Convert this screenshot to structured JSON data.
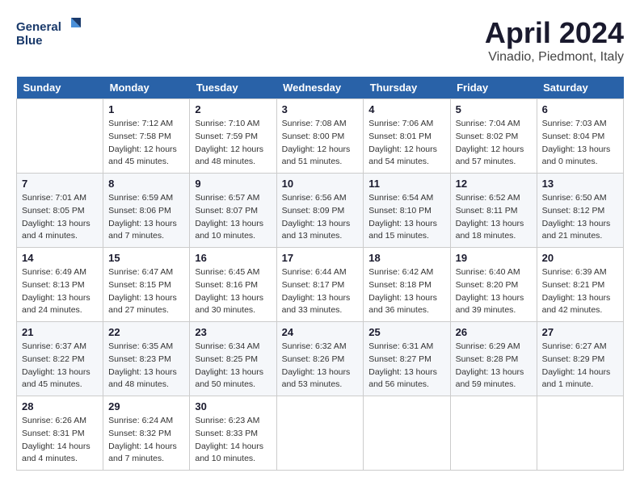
{
  "logo": {
    "text_line1": "General",
    "text_line2": "Blue"
  },
  "title": {
    "month_year": "April 2024",
    "location": "Vinadio, Piedmont, Italy"
  },
  "columns": [
    "Sunday",
    "Monday",
    "Tuesday",
    "Wednesday",
    "Thursday",
    "Friday",
    "Saturday"
  ],
  "weeks": [
    [
      {
        "day": "",
        "info": ""
      },
      {
        "day": "1",
        "info": "Sunrise: 7:12 AM\nSunset: 7:58 PM\nDaylight: 12 hours\nand 45 minutes."
      },
      {
        "day": "2",
        "info": "Sunrise: 7:10 AM\nSunset: 7:59 PM\nDaylight: 12 hours\nand 48 minutes."
      },
      {
        "day": "3",
        "info": "Sunrise: 7:08 AM\nSunset: 8:00 PM\nDaylight: 12 hours\nand 51 minutes."
      },
      {
        "day": "4",
        "info": "Sunrise: 7:06 AM\nSunset: 8:01 PM\nDaylight: 12 hours\nand 54 minutes."
      },
      {
        "day": "5",
        "info": "Sunrise: 7:04 AM\nSunset: 8:02 PM\nDaylight: 12 hours\nand 57 minutes."
      },
      {
        "day": "6",
        "info": "Sunrise: 7:03 AM\nSunset: 8:04 PM\nDaylight: 13 hours\nand 0 minutes."
      }
    ],
    [
      {
        "day": "7",
        "info": "Sunrise: 7:01 AM\nSunset: 8:05 PM\nDaylight: 13 hours\nand 4 minutes."
      },
      {
        "day": "8",
        "info": "Sunrise: 6:59 AM\nSunset: 8:06 PM\nDaylight: 13 hours\nand 7 minutes."
      },
      {
        "day": "9",
        "info": "Sunrise: 6:57 AM\nSunset: 8:07 PM\nDaylight: 13 hours\nand 10 minutes."
      },
      {
        "day": "10",
        "info": "Sunrise: 6:56 AM\nSunset: 8:09 PM\nDaylight: 13 hours\nand 13 minutes."
      },
      {
        "day": "11",
        "info": "Sunrise: 6:54 AM\nSunset: 8:10 PM\nDaylight: 13 hours\nand 15 minutes."
      },
      {
        "day": "12",
        "info": "Sunrise: 6:52 AM\nSunset: 8:11 PM\nDaylight: 13 hours\nand 18 minutes."
      },
      {
        "day": "13",
        "info": "Sunrise: 6:50 AM\nSunset: 8:12 PM\nDaylight: 13 hours\nand 21 minutes."
      }
    ],
    [
      {
        "day": "14",
        "info": "Sunrise: 6:49 AM\nSunset: 8:13 PM\nDaylight: 13 hours\nand 24 minutes."
      },
      {
        "day": "15",
        "info": "Sunrise: 6:47 AM\nSunset: 8:15 PM\nDaylight: 13 hours\nand 27 minutes."
      },
      {
        "day": "16",
        "info": "Sunrise: 6:45 AM\nSunset: 8:16 PM\nDaylight: 13 hours\nand 30 minutes."
      },
      {
        "day": "17",
        "info": "Sunrise: 6:44 AM\nSunset: 8:17 PM\nDaylight: 13 hours\nand 33 minutes."
      },
      {
        "day": "18",
        "info": "Sunrise: 6:42 AM\nSunset: 8:18 PM\nDaylight: 13 hours\nand 36 minutes."
      },
      {
        "day": "19",
        "info": "Sunrise: 6:40 AM\nSunset: 8:20 PM\nDaylight: 13 hours\nand 39 minutes."
      },
      {
        "day": "20",
        "info": "Sunrise: 6:39 AM\nSunset: 8:21 PM\nDaylight: 13 hours\nand 42 minutes."
      }
    ],
    [
      {
        "day": "21",
        "info": "Sunrise: 6:37 AM\nSunset: 8:22 PM\nDaylight: 13 hours\nand 45 minutes."
      },
      {
        "day": "22",
        "info": "Sunrise: 6:35 AM\nSunset: 8:23 PM\nDaylight: 13 hours\nand 48 minutes."
      },
      {
        "day": "23",
        "info": "Sunrise: 6:34 AM\nSunset: 8:25 PM\nDaylight: 13 hours\nand 50 minutes."
      },
      {
        "day": "24",
        "info": "Sunrise: 6:32 AM\nSunset: 8:26 PM\nDaylight: 13 hours\nand 53 minutes."
      },
      {
        "day": "25",
        "info": "Sunrise: 6:31 AM\nSunset: 8:27 PM\nDaylight: 13 hours\nand 56 minutes."
      },
      {
        "day": "26",
        "info": "Sunrise: 6:29 AM\nSunset: 8:28 PM\nDaylight: 13 hours\nand 59 minutes."
      },
      {
        "day": "27",
        "info": "Sunrise: 6:27 AM\nSunset: 8:29 PM\nDaylight: 14 hours\nand 1 minute."
      }
    ],
    [
      {
        "day": "28",
        "info": "Sunrise: 6:26 AM\nSunset: 8:31 PM\nDaylight: 14 hours\nand 4 minutes."
      },
      {
        "day": "29",
        "info": "Sunrise: 6:24 AM\nSunset: 8:32 PM\nDaylight: 14 hours\nand 7 minutes."
      },
      {
        "day": "30",
        "info": "Sunrise: 6:23 AM\nSunset: 8:33 PM\nDaylight: 14 hours\nand 10 minutes."
      },
      {
        "day": "",
        "info": ""
      },
      {
        "day": "",
        "info": ""
      },
      {
        "day": "",
        "info": ""
      },
      {
        "day": "",
        "info": ""
      }
    ]
  ]
}
